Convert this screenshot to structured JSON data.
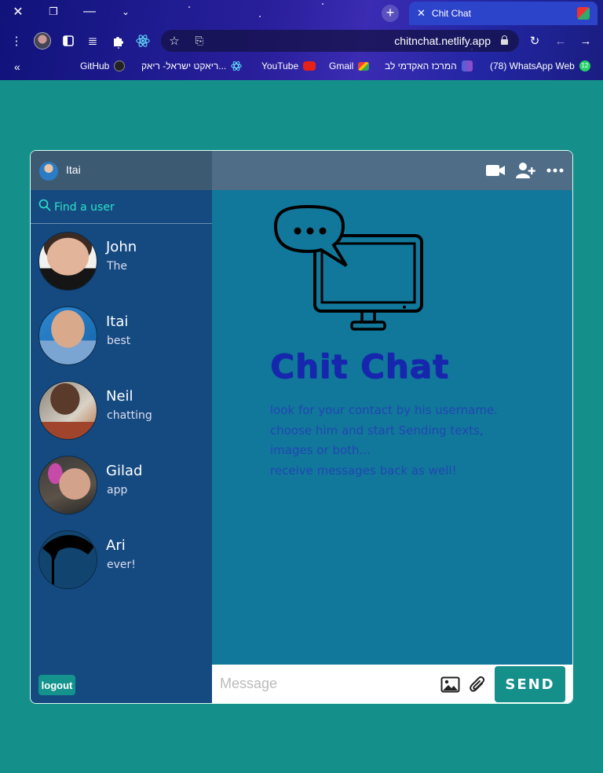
{
  "browser": {
    "tab_title": "Chit Chat",
    "url": "chitnchat.netlify.app",
    "bookmarks": [
      {
        "label": "GitHub",
        "icon": "github-icon"
      },
      {
        "label": "ריאקט ישראל- ריאק...",
        "icon": "react-icon"
      },
      {
        "label": "YouTube",
        "icon": "youtube-icon"
      },
      {
        "label": "Gmail",
        "icon": "gmail-icon"
      },
      {
        "label": "המרכז האקדמי לב",
        "icon": "jct-icon"
      },
      {
        "label": "(78) WhatsApp Web",
        "icon": "whatsapp-icon",
        "badge": "12"
      }
    ]
  },
  "sidebar": {
    "current_user": "Itai",
    "search_placeholder": "Find a user",
    "users": [
      {
        "name": "John",
        "last_message": "The"
      },
      {
        "name": "Itai",
        "last_message": "best"
      },
      {
        "name": "Neil",
        "last_message": "chatting"
      },
      {
        "name": "Gilad",
        "last_message": "app"
      },
      {
        "name": "Ari",
        "last_message": "ever!"
      }
    ],
    "logout_label": "logout"
  },
  "main": {
    "brand": "Chit Chat",
    "instructions": [
      "look for your contact by his username.",
      "choose him and start Sending texts,",
      "images or both...",
      "receive messages back as well!"
    ]
  },
  "composer": {
    "placeholder": "Message",
    "send_label": "SEND"
  },
  "colors": {
    "page_bg": "#148f8a",
    "sidebar_bg": "#154a81",
    "main_bg": "#11789b",
    "brand_text": "#1627ad",
    "search_text": "#2ce3c8"
  }
}
